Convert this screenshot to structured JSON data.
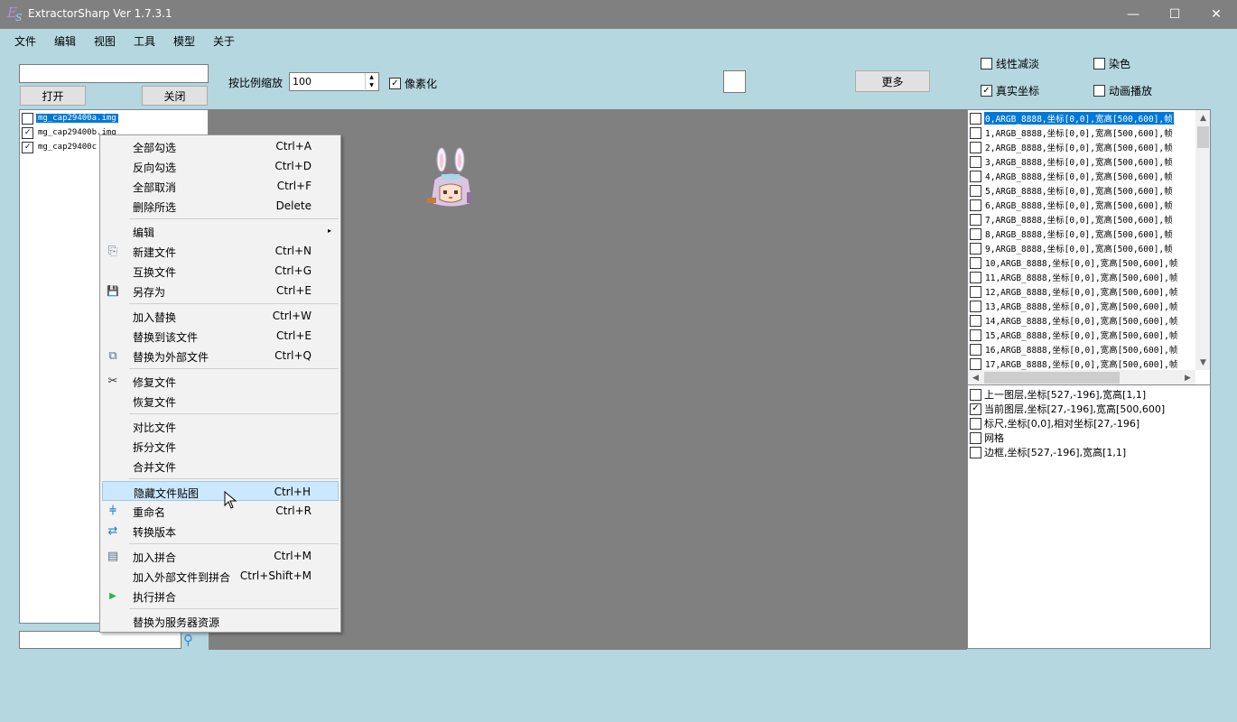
{
  "window": {
    "title": "ExtractorSharp Ver 1.7.3.1",
    "logo_main": "E",
    "logo_sub": "S",
    "minimize_glyph": "—",
    "maximize_glyph": "☐",
    "close_glyph": "✕"
  },
  "menubar": [
    "文件",
    "编辑",
    "视图",
    "工具",
    "模型",
    "关于"
  ],
  "top_left": {
    "path_value": "",
    "open_label": "打开",
    "close_label": "关闭"
  },
  "toolbar": {
    "scale_label": "按比例缩放",
    "scale_value": "100",
    "pixelate_label": "像素化",
    "pixelate_checked": true,
    "more_label": "更多"
  },
  "right_options": [
    {
      "label": "线性减淡",
      "checked": false
    },
    {
      "label": "染色",
      "checked": false
    },
    {
      "label": "真实坐标",
      "checked": true
    },
    {
      "label": "动画播放",
      "checked": false
    }
  ],
  "file_list": [
    {
      "name": "mg_cap29400a.img",
      "checked": false,
      "selected": true
    },
    {
      "name": "mg_cap29400b.img",
      "checked": true,
      "selected": false
    },
    {
      "name": "mg_cap29400c",
      "checked": true,
      "selected": false
    }
  ],
  "frames": [
    "0,ARGB_8888,坐标[0,0],宽高[500,600],帧",
    "1,ARGB_8888,坐标[0,0],宽高[500,600],帧",
    "2,ARGB_8888,坐标[0,0],宽高[500,600],帧",
    "3,ARGB_8888,坐标[0,0],宽高[500,600],帧",
    "4,ARGB_8888,坐标[0,0],宽高[500,600],帧",
    "5,ARGB_8888,坐标[0,0],宽高[500,600],帧",
    "6,ARGB_8888,坐标[0,0],宽高[500,600],帧",
    "7,ARGB_8888,坐标[0,0],宽高[500,600],帧",
    "8,ARGB_8888,坐标[0,0],宽高[500,600],帧",
    "9,ARGB_8888,坐标[0,0],宽高[500,600],帧",
    "10,ARGB_8888,坐标[0,0],宽高[500,600],帧",
    "11,ARGB_8888,坐标[0,0],宽高[500,600],帧",
    "12,ARGB_8888,坐标[0,0],宽高[500,600],帧",
    "13,ARGB_8888,坐标[0,0],宽高[500,600],帧",
    "14,ARGB_8888,坐标[0,0],宽高[500,600],帧",
    "15,ARGB_8888,坐标[0,0],宽高[500,600],帧",
    "16,ARGB_8888,坐标[0,0],宽高[500,600],帧",
    "17,ARGB_8888,坐标[0,0],宽高[500,600],帧"
  ],
  "layers": [
    {
      "label": "上一图层,坐标[527,-196],宽高[1,1]",
      "checked": false
    },
    {
      "label": "当前图层,坐标[27,-196],宽高[500,600]",
      "checked": true
    },
    {
      "label": "标尺,坐标[0,0],相对坐标[27,-196]",
      "checked": false
    },
    {
      "label": "网格",
      "checked": false
    },
    {
      "label": "边框,坐标[527,-196],宽高[1,1]",
      "checked": false
    }
  ],
  "context_menu": [
    {
      "label": "全部勾选",
      "shortcut": "Ctrl+A"
    },
    {
      "label": "反向勾选",
      "shortcut": "Ctrl+D"
    },
    {
      "label": "全部取消",
      "shortcut": "Ctrl+F"
    },
    {
      "label": "删除所选",
      "shortcut": "Delete"
    },
    {
      "label": "编辑",
      "shortcut": ""
    },
    {
      "label": "新建文件",
      "shortcut": "Ctrl+N"
    },
    {
      "label": "互换文件",
      "shortcut": "Ctrl+G"
    },
    {
      "label": "另存为",
      "shortcut": "Ctrl+E"
    },
    {
      "label": "加入替换",
      "shortcut": "Ctrl+W"
    },
    {
      "label": "替换到该文件",
      "shortcut": "Ctrl+E"
    },
    {
      "label": "替换为外部文件",
      "shortcut": "Ctrl+Q"
    },
    {
      "label": "修复文件",
      "shortcut": ""
    },
    {
      "label": "恢复文件",
      "shortcut": ""
    },
    {
      "label": "对比文件",
      "shortcut": ""
    },
    {
      "label": "拆分文件",
      "shortcut": ""
    },
    {
      "label": "合并文件",
      "shortcut": ""
    },
    {
      "label": "隐藏文件贴图",
      "shortcut": "Ctrl+H"
    },
    {
      "label": "重命名",
      "shortcut": "Ctrl+R"
    },
    {
      "label": "转换版本",
      "shortcut": ""
    },
    {
      "label": "加入拼合",
      "shortcut": "Ctrl+M"
    },
    {
      "label": "加入外部文件到拼合",
      "shortcut": "Ctrl+Shift+M"
    },
    {
      "label": "执行拼合",
      "shortcut": ""
    },
    {
      "label": "替换为服务器资源",
      "shortcut": ""
    }
  ],
  "icons": {
    "submenu_arrow": "▸",
    "new_file": "⎘",
    "save_as": "💾",
    "replace_external": "⧉",
    "repair": "✂",
    "rename": "⫩",
    "convert": "⇄",
    "add_merge": "▤",
    "run_merge": "▶",
    "search": "⚲",
    "spin_up": "▲",
    "spin_down": "▼",
    "scroll_up": "▲",
    "scroll_down": "▼",
    "scroll_left": "◀",
    "scroll_right": "▶",
    "check": "✓"
  },
  "search": {
    "value": ""
  }
}
